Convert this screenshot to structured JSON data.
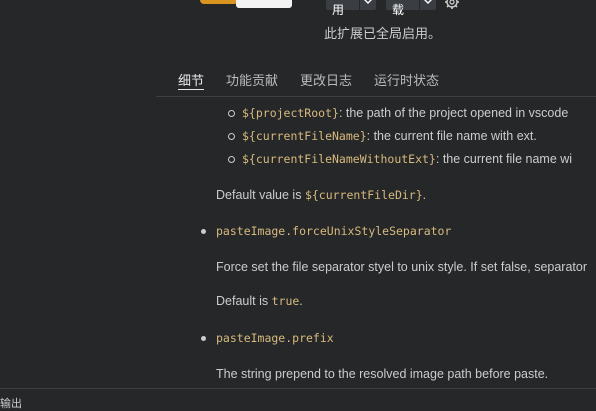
{
  "header": {
    "disable_label": "禁用",
    "uninstall_label": "卸载",
    "enabled_message": "此扩展已全局启用。"
  },
  "tabs": [
    {
      "label": "细节",
      "active": true
    },
    {
      "label": "功能贡献",
      "active": false
    },
    {
      "label": "更改日志",
      "active": false
    },
    {
      "label": "运行时状态",
      "active": false
    }
  ],
  "content": {
    "sub_items": [
      {
        "code": "${projectRoot}",
        "text": ": the path of the project opened in vscode"
      },
      {
        "code": "${currentFileName}",
        "text": ": the current file name with ext."
      },
      {
        "code": "${currentFileNameWithoutExt}",
        "text": ": the current file name wi"
      }
    ],
    "default_value_prefix": "Default value is ",
    "default_value_code": "${currentFileDir}",
    "default_value_suffix": ".",
    "settings": [
      {
        "name": "pasteImage.forceUnixStyleSeparator",
        "description": "Force set the file separator styel to unix style. If set false, separator",
        "default_prefix": "Default is ",
        "default_code": "true",
        "default_suffix": "."
      },
      {
        "name": "pasteImage.prefix",
        "description": "The string prepend to the resolved image path before paste."
      }
    ]
  },
  "bottom_panel": {
    "label": "输出"
  }
}
